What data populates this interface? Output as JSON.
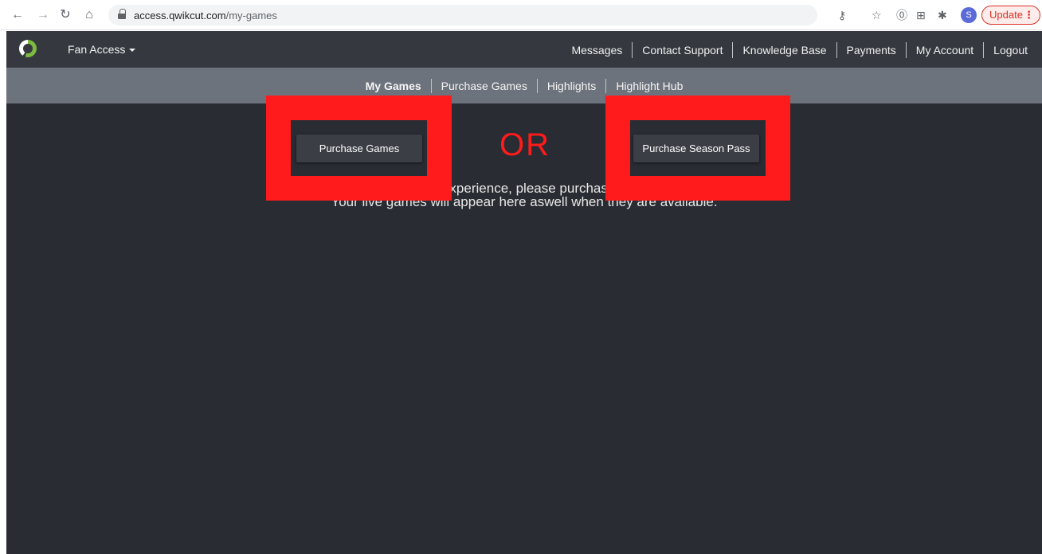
{
  "browser": {
    "url_host": "access.qwikcut.com",
    "url_path": "/my-games",
    "profile_initial": "S",
    "update_label": "Update",
    "update_dots": "⋮"
  },
  "header": {
    "menu_label": "Fan Access",
    "links": [
      "Messages",
      "Contact Support",
      "Knowledge Base",
      "Payments",
      "My Account",
      "Logout"
    ]
  },
  "subnav": {
    "items": [
      "My Games",
      "Purchase Games",
      "Highlights",
      "Highlight Hub"
    ],
    "active": "My Games"
  },
  "main": {
    "message_line1": "Experience, please purchas",
    "message_line2": "Your live games will appear here aswell when they are available.",
    "purchase_games_button": "Purchase Games",
    "or_label": "OR",
    "season_pass_button": "Purchase Season Pass"
  },
  "colors": {
    "annotation_red": "#ff1b1b",
    "header_bg": "#35383f",
    "subnav_bg": "#6d737c",
    "content_bg": "#2a2c33"
  }
}
